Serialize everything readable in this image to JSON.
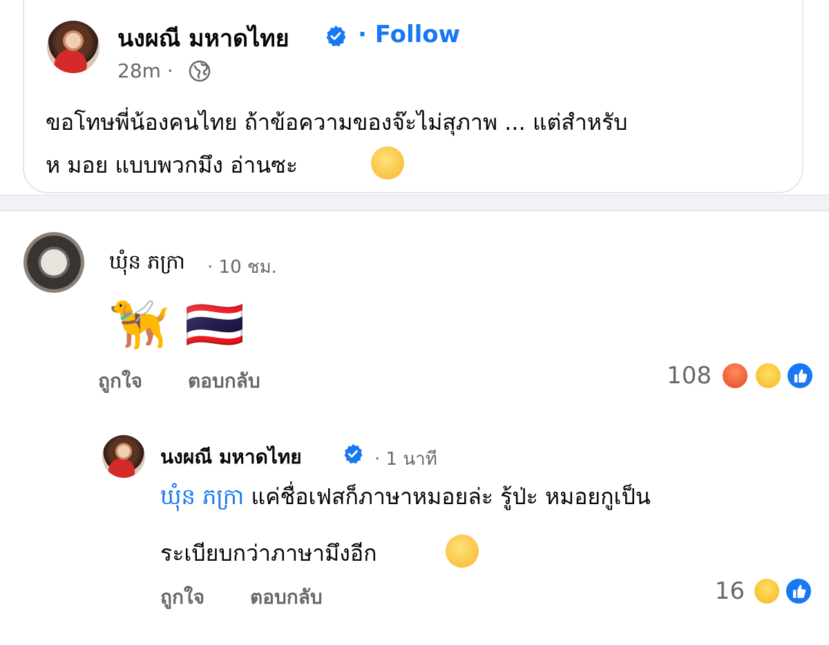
{
  "post": {
    "author": "นงผณี มหาดไทย",
    "follow_label": "· Follow",
    "time": "28m ·",
    "text_line1": "ขอโทษพี่น้องคนไทย ถ้าข้อความของจ๊ะไม่สุภาพ ... แต่สำหรับ",
    "text_line2": "ห มอย แบบพวกมึง อ่านซะ",
    "privacy_icon": "globe-icon"
  },
  "comment": {
    "author": "ឃុំន ភក្រា",
    "time": "· 10 ชม.",
    "emoji": "🦮 🇹🇭",
    "like_label": "ถูกใจ",
    "reply_label": "ตอบกลับ",
    "reaction_count": "108",
    "reactions": [
      "angry-icon",
      "haha-icon",
      "like-icon"
    ]
  },
  "reply": {
    "author": "นงผณี มหาดไทย",
    "time": "· 1 นาที",
    "mention": "ឃុំន ភក្រា",
    "text_line1": "แค่ชื่อเฟสก็ภาษาหมอยล่ะ รู้ป่ะ หมอยกูเป็น",
    "text_line2": "ระเบียบกว่าภาษามึงอีก",
    "like_label": "ถูกใจ",
    "reply_label": "ตอบกลับ",
    "reaction_count": "16",
    "reactions": [
      "haha-icon",
      "like-icon"
    ]
  },
  "colors": {
    "accent": "#1877f2",
    "secondary_text": "#65676b",
    "divider": "#f0f2f5"
  }
}
